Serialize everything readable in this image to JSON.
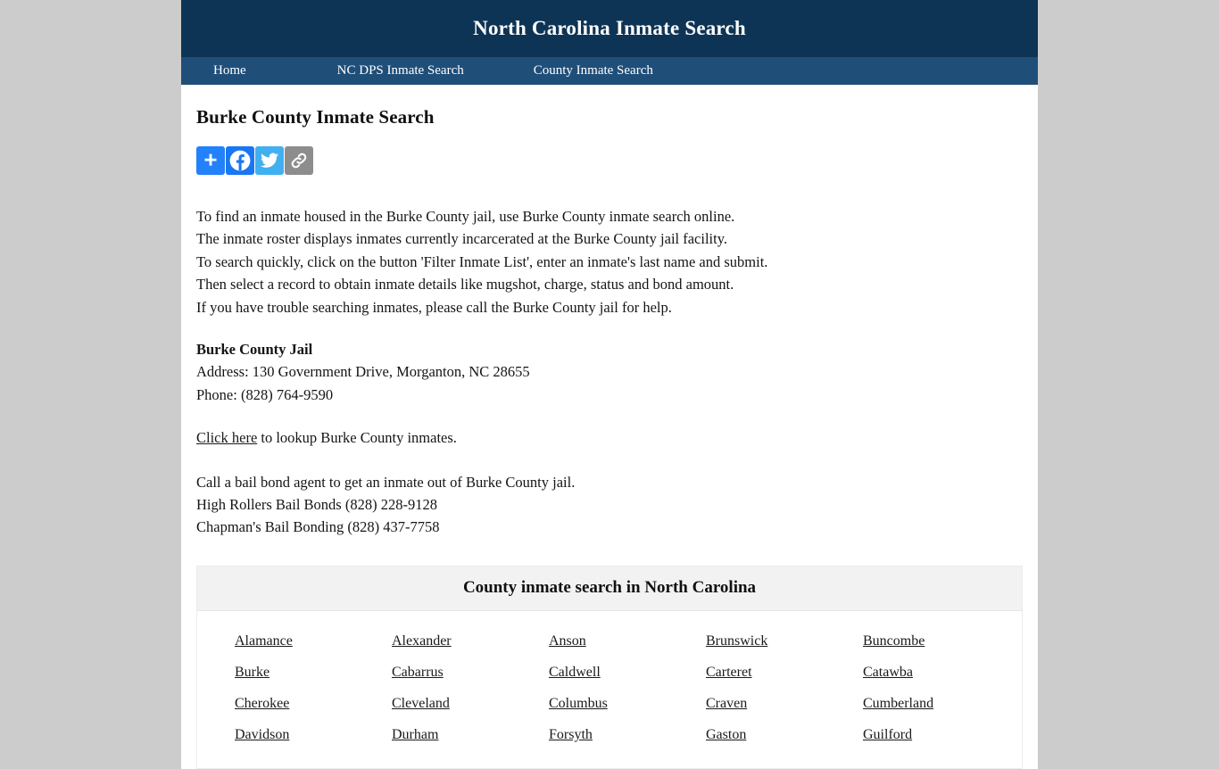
{
  "header": {
    "title": "North Carolina Inmate Search"
  },
  "nav": {
    "items": [
      {
        "label": "Home"
      },
      {
        "label": "NC DPS Inmate Search"
      },
      {
        "label": "County Inmate Search"
      }
    ]
  },
  "main": {
    "page_title": "Burke County Inmate Search",
    "share": {
      "buttons": [
        {
          "name": "addthis-share-icon",
          "label": "Share",
          "color": "#2281fb"
        },
        {
          "name": "facebook-icon",
          "label": "Facebook",
          "color": "#1877f2"
        },
        {
          "name": "twitter-icon",
          "label": "Twitter",
          "color": "#41b0f0"
        },
        {
          "name": "copy-link-icon",
          "label": "Copy Link",
          "color": "#8d8d8d"
        }
      ]
    },
    "intro_lines": [
      "To find an inmate housed in the Burke County jail, use Burke County inmate search online.",
      "The inmate roster displays inmates currently incarcerated at the Burke County jail facility.",
      "To search quickly, click on the button 'Filter Inmate List', enter an inmate's last name and submit.",
      "Then select a record to obtain inmate details like mugshot, charge, status and bond amount.",
      "If you have trouble searching inmates, please call the Burke County jail for help."
    ],
    "jail": {
      "name": "Burke County Jail",
      "address": "Address: 130 Government Drive, Morganton, NC 28655",
      "phone": "Phone: (828) 764-9590"
    },
    "lookup": {
      "link_text": "Click here",
      "rest_text": " to lookup Burke County inmates."
    },
    "bail": {
      "intro": "Call a bail bond agent to get an inmate out of Burke County jail.",
      "agents": [
        "High Rollers Bail Bonds (828) 228-9128",
        "Chapman's Bail Bonding (828) 437-7758"
      ]
    },
    "counties": {
      "heading": "County inmate search in North Carolina",
      "items": [
        "Alamance",
        "Alexander",
        "Anson",
        "Brunswick",
        "Buncombe",
        "Burke",
        "Cabarrus",
        "Caldwell",
        "Carteret",
        "Catawba",
        "Cherokee",
        "Cleveland",
        "Columbus",
        "Craven",
        "Cumberland",
        "Davidson",
        "Durham",
        "Forsyth",
        "Gaston",
        "Guilford"
      ]
    }
  },
  "colors": {
    "header_bg": "#0e3455",
    "nav_bg": "#1f4e79",
    "body_bg": "#cccccc",
    "section_bg": "#f2f2f2"
  }
}
